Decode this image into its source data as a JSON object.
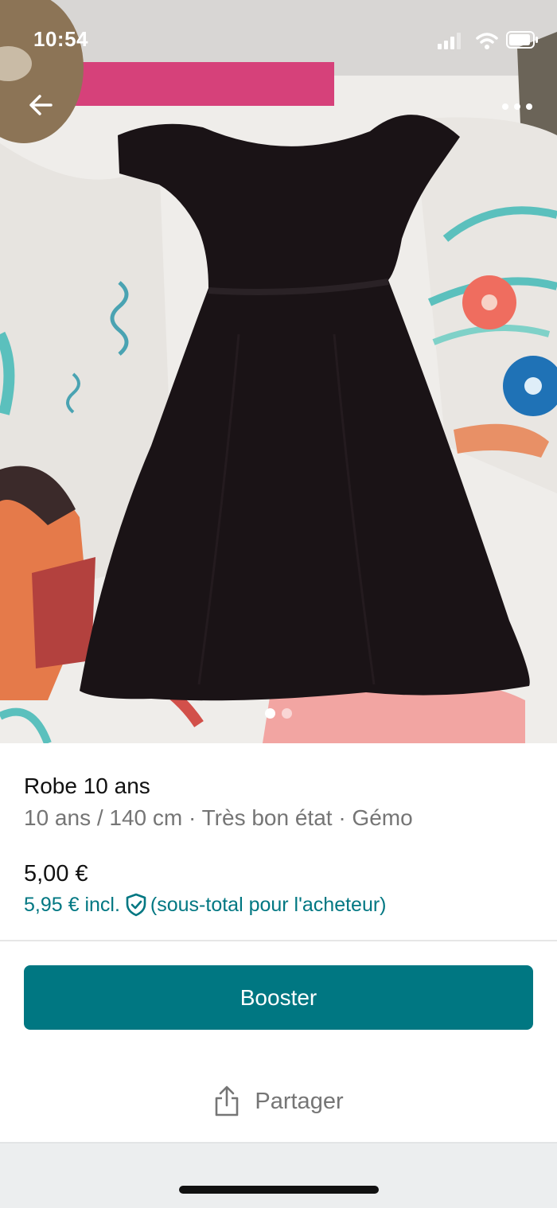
{
  "status_bar": {
    "time": "10:54",
    "icons": [
      "signal-icon",
      "wifi-icon",
      "battery-icon"
    ]
  },
  "header": {
    "back_icon": "arrow-left-icon",
    "more_icon": "more-horizontal-icon"
  },
  "gallery": {
    "image_count": 2,
    "active_index": 0
  },
  "item": {
    "title": "Robe 10 ans",
    "subtitle": "10 ans / 140 cm · Très bon état · Gémo",
    "price": "5,00 €",
    "buyer_price_amount": "5,95 € incl.",
    "buyer_price_note": "(sous-total pour l'acheteur)",
    "buyer_price_icon": "shield-check-icon"
  },
  "actions": {
    "booster_label": "Booster",
    "share_label": "Partager",
    "share_icon": "share-icon"
  },
  "colors": {
    "accent": "#007782",
    "text_primary": "#111111",
    "text_secondary": "#757575"
  }
}
